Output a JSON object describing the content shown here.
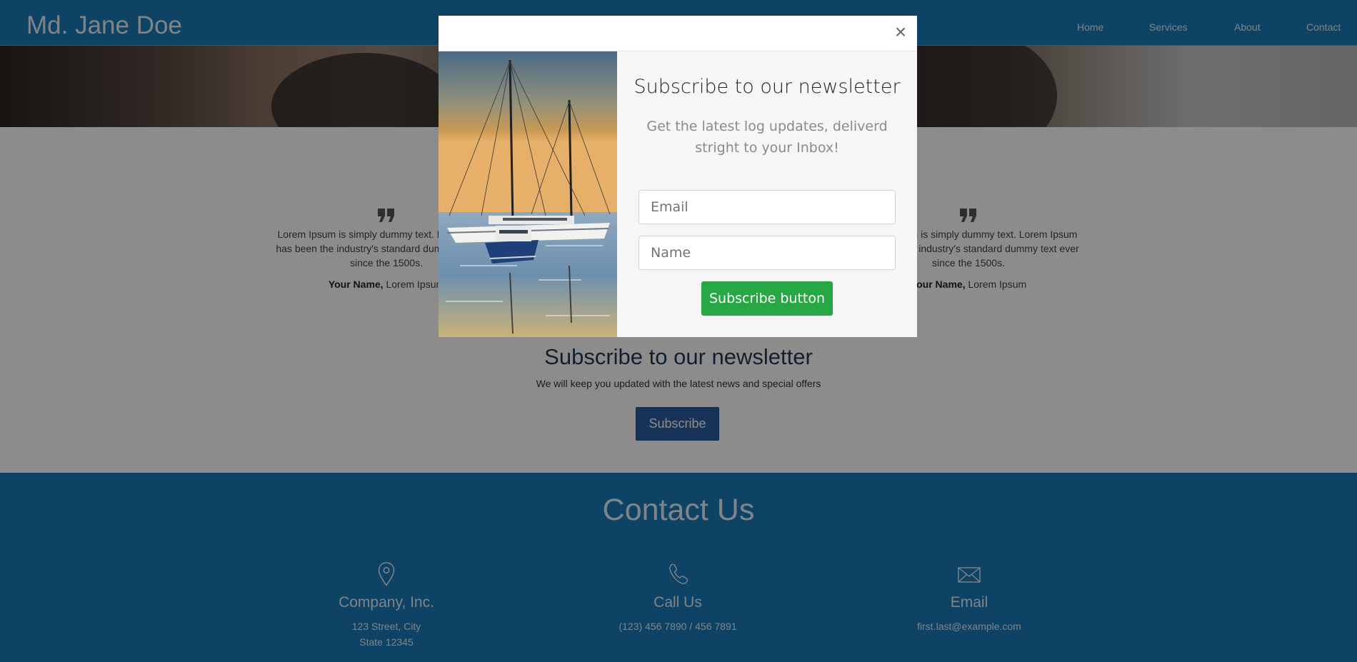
{
  "header": {
    "brand": "Md. Jane Doe",
    "nav": [
      "Home",
      "Services",
      "About",
      "Contact"
    ]
  },
  "testimonials": [
    {
      "icon": "quote-icon",
      "text": "Lorem Ipsum is simply dummy text. Lorem Ipsum has been the industry's standard dummy text ever since the 1500s.",
      "name": "Your Name,",
      "role": "Lorem Ipsum"
    },
    {
      "icon": "quote-icon",
      "text": "Lorem Ipsum is simply dummy text. Lorem Ipsum has been the industry's standard dummy text ever since the 1500s.",
      "name": "Your Name,",
      "role": "Lorem Ipsum"
    }
  ],
  "newsletter_section": {
    "title": "Subscribe to our newsletter",
    "subtitle": "We will keep you updated with the latest news and special offers",
    "button": "Subscribe"
  },
  "contact": {
    "title": "Contact Us",
    "columns": [
      {
        "icon": "location-pin-icon",
        "title": "Company, Inc.",
        "lines": [
          "123 Street, City",
          "State 12345"
        ]
      },
      {
        "icon": "phone-icon",
        "title": "Call Us",
        "lines": [
          "(123) 456 7890 / 456 7891"
        ]
      },
      {
        "icon": "envelope-icon",
        "title": "Email",
        "lines": [
          "first.last@example.com"
        ]
      }
    ]
  },
  "modal": {
    "close_symbol": "×",
    "image": "sailboats-photo",
    "title": "Subscribe to our newsletter",
    "subtitle": "Get the latest log updates, deliverd stright to your Inbox!",
    "email_placeholder": "Email",
    "name_placeholder": "Name",
    "button": "Subscribe button"
  },
  "colors": {
    "nav_bg": "#1a7ab9",
    "subscribe_button": "#2a5d9f",
    "modal_button": "#28a745",
    "overlay": "rgba(0,0,0,0.45)"
  }
}
